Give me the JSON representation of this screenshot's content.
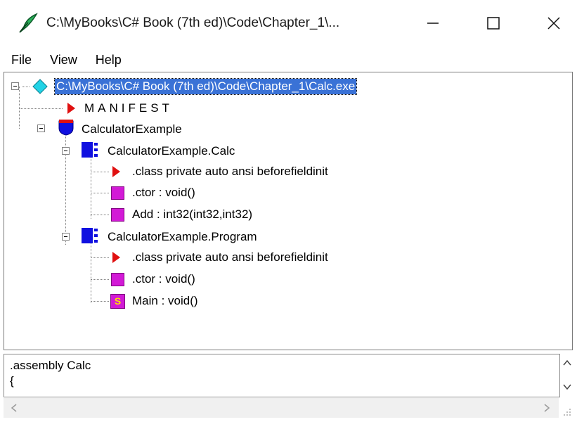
{
  "window": {
    "title": "C:\\MyBooks\\C# Book (7th ed)\\Code\\Chapter_1\\...",
    "icon": "ildasm-quill-icon",
    "controls": [
      "minimize-icon",
      "maximize-icon",
      "close-icon"
    ]
  },
  "menu": [
    "File",
    "View",
    "Help"
  ],
  "tree": {
    "root": "C:\\MyBooks\\C# Book (7th ed)\\Code\\Chapter_1\\Calc.exe",
    "manifest": "MANIFEST",
    "namespace": "CalculatorExample",
    "classes": [
      {
        "name": "CalculatorExample.Calc",
        "members": [
          ".class private auto ansi beforefieldinit",
          ".ctor : void()",
          "Add : int32(int32,int32)"
        ]
      },
      {
        "name": "CalculatorExample.Program",
        "members": [
          ".class private auto ansi beforefieldinit",
          ".ctor : void()",
          "Main : void()"
        ]
      }
    ],
    "static_badge": "S"
  },
  "il_panel": {
    "lines": [
      ".assembly Calc",
      "{"
    ]
  },
  "colors": {
    "selection": "#3a72d6",
    "class_icon": "#1010e0",
    "method_icon": "#d21ad6",
    "directive_icon": "#e01010",
    "root_icon": "#22d3e6"
  }
}
